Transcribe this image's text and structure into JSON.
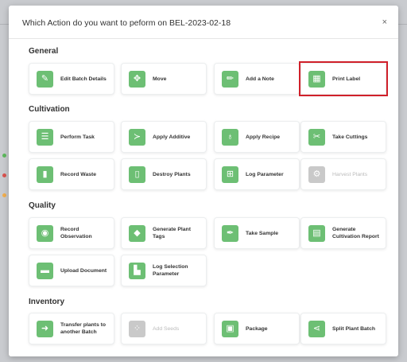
{
  "modal": {
    "title": "Which Action do you want to peform on BEL-2023-02-18",
    "close_label": "×"
  },
  "sections": {
    "general": "General",
    "cultivation": "Cultivation",
    "quality": "Quality",
    "inventory": "Inventory"
  },
  "actions": {
    "edit_batch_details": {
      "label": "Edit Batch Details",
      "icon": "edit-icon"
    },
    "move": {
      "label": "Move",
      "icon": "move-icon"
    },
    "add_note": {
      "label": "Add a Note",
      "icon": "pencil-icon"
    },
    "print_label": {
      "label": "Print Label",
      "icon": "grid-icon"
    },
    "perform_task": {
      "label": "Perform Task",
      "icon": "list-icon"
    },
    "apply_additive": {
      "label": "Apply Additive",
      "icon": "fish-icon"
    },
    "apply_recipe": {
      "label": "Apply Recipe",
      "icon": "bag-icon"
    },
    "take_cuttings": {
      "label": "Take Cuttings",
      "icon": "scissors-icon"
    },
    "record_waste": {
      "label": "Record Waste",
      "icon": "trash-icon"
    },
    "destroy_plants": {
      "label": "Destroy Plants",
      "icon": "trash-bin-icon"
    },
    "log_parameter": {
      "label": "Log Parameter",
      "icon": "table-icon"
    },
    "harvest_plants": {
      "label": "Harvest Plants",
      "icon": "tractor-icon"
    },
    "record_observation": {
      "label": "Record Observation",
      "icon": "eye-icon"
    },
    "generate_plant_tags": {
      "label": "Generate Plant Tags",
      "icon": "tag-icon"
    },
    "take_sample": {
      "label": "Take Sample",
      "icon": "pipette-icon"
    },
    "generate_cultivation_report": {
      "label": "Generate Cultivation Report",
      "icon": "report-icon"
    },
    "upload_document": {
      "label": "Upload Document",
      "icon": "document-icon"
    },
    "log_selection_parameter": {
      "label": "Log Selection Parameter",
      "icon": "selection-icon"
    },
    "transfer_plants": {
      "label": "Transfer plants to another Batch",
      "icon": "arrow-right-icon"
    },
    "add_seeds": {
      "label": "Add Seeds",
      "icon": "seeds-icon"
    },
    "package": {
      "label": "Package",
      "icon": "package-icon"
    },
    "split_plant_batch": {
      "label": "Split Plant Batch",
      "icon": "split-icon"
    }
  },
  "colors": {
    "accent_green": "#6dbf74",
    "disabled_gray": "#c9c9c9",
    "highlight_red": "#d0202a"
  }
}
